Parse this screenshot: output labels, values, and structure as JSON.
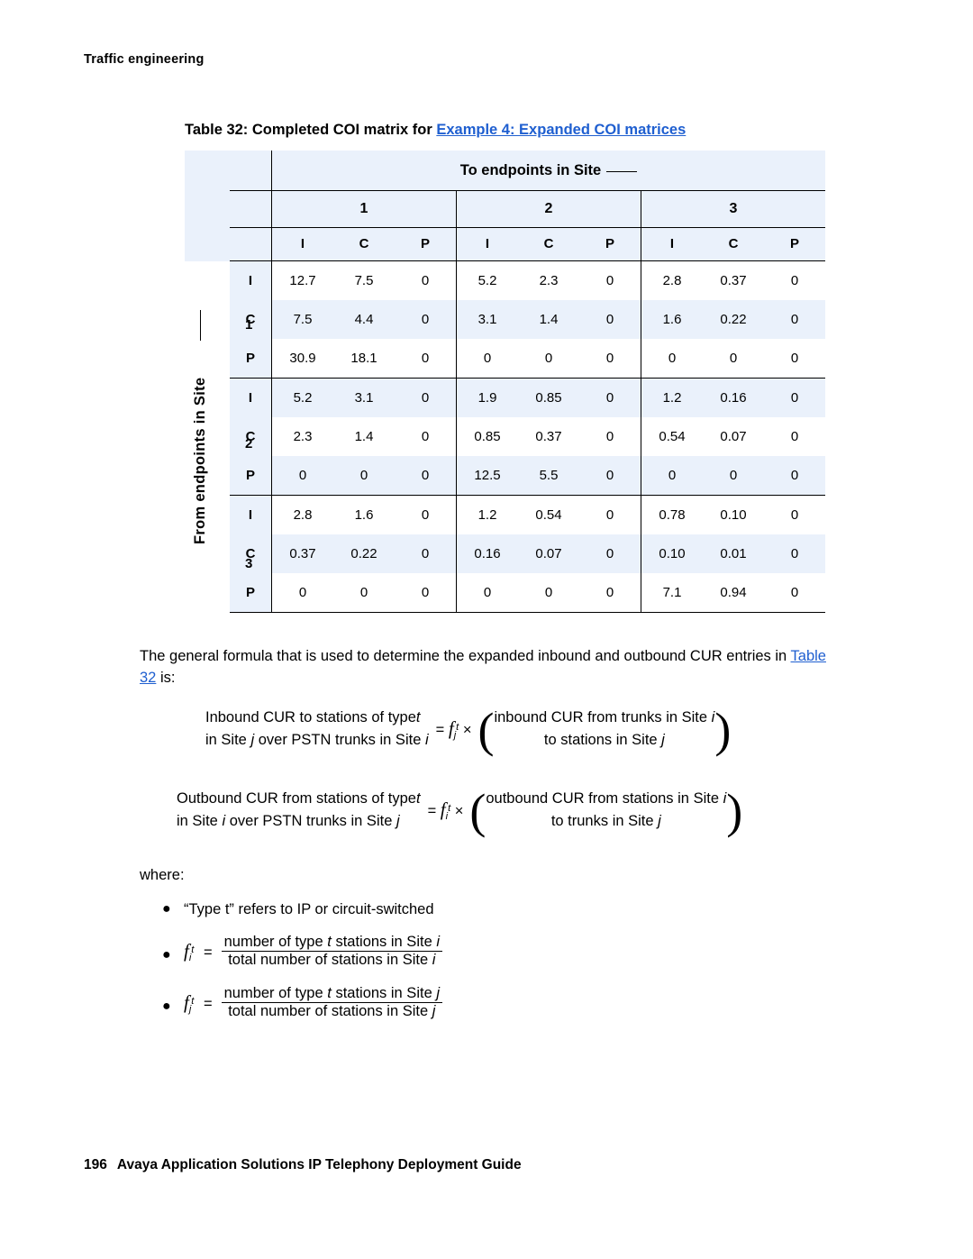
{
  "running_head": "Traffic engineering",
  "caption": {
    "prefix": "Table 32: Completed COI matrix for ",
    "link": "Example 4: Expanded COI matrices"
  },
  "matrix": {
    "col_group_title": "To endpoints in Site",
    "row_group_title": "From endpoints in Site",
    "site_numbers": [
      "1",
      "2",
      "3"
    ],
    "type_labels": [
      "I",
      "C",
      "P"
    ],
    "rows": [
      {
        "site": "1",
        "type": "I",
        "values": [
          "12.7",
          "7.5",
          "0",
          "5.2",
          "2.3",
          "0",
          "2.8",
          "0.37",
          "0"
        ]
      },
      {
        "site": "1",
        "type": "C",
        "values": [
          "7.5",
          "4.4",
          "0",
          "3.1",
          "1.4",
          "0",
          "1.6",
          "0.22",
          "0"
        ]
      },
      {
        "site": "1",
        "type": "P",
        "values": [
          "30.9",
          "18.1",
          "0",
          "0",
          "0",
          "0",
          "0",
          "0",
          "0"
        ]
      },
      {
        "site": "2",
        "type": "I",
        "values": [
          "5.2",
          "3.1",
          "0",
          "1.9",
          "0.85",
          "0",
          "1.2",
          "0.16",
          "0"
        ]
      },
      {
        "site": "2",
        "type": "C",
        "values": [
          "2.3",
          "1.4",
          "0",
          "0.85",
          "0.37",
          "0",
          "0.54",
          "0.07",
          "0"
        ]
      },
      {
        "site": "2",
        "type": "P",
        "values": [
          "0",
          "0",
          "0",
          "12.5",
          "5.5",
          "0",
          "0",
          "0",
          "0"
        ]
      },
      {
        "site": "3",
        "type": "I",
        "values": [
          "2.8",
          "1.6",
          "0",
          "1.2",
          "0.54",
          "0",
          "0.78",
          "0.10",
          "0"
        ]
      },
      {
        "site": "3",
        "type": "C",
        "values": [
          "0.37",
          "0.22",
          "0",
          "0.16",
          "0.07",
          "0",
          "0.10",
          "0.01",
          "0"
        ]
      },
      {
        "site": "3",
        "type": "P",
        "values": [
          "0",
          "0",
          "0",
          "0",
          "0",
          "0",
          "7.1",
          "0.94",
          "0"
        ]
      }
    ]
  },
  "body": {
    "intro_part1": "The general formula that is used to determine the expanded inbound and outbound CUR entries in ",
    "intro_link": "Table 32",
    "intro_part2": " is:",
    "where_label": "where:",
    "bullet_type": "“Type t” refers to IP or circuit-switched"
  },
  "formula1": {
    "lhs_line1_a": "Inbound CUR to stations of type",
    "lhs_line1_t": "t",
    "lhs_line2_a": "in Site",
    "lhs_line2_j": "j",
    "lhs_line2_b": "over PSTN trunks in Site",
    "lhs_line2_i": "i",
    "eq": "=",
    "factor_f": "f",
    "factor_sub": "j",
    "factor_sup": "t",
    "times": "×",
    "rhs_line1_a": "inbound CUR from trunks in Site",
    "rhs_line1_i": "i",
    "rhs_line2_a": "to stations in Site",
    "rhs_line2_j": "j"
  },
  "formula2": {
    "lhs_line1_a": "Outbound CUR from stations of type",
    "lhs_line1_t": "t",
    "lhs_line2_a": "in Site",
    "lhs_line2_i": "i",
    "lhs_line2_b": "over PSTN trunks in Site",
    "lhs_line2_j": "j",
    "eq": "=",
    "factor_f": "f",
    "factor_sub": "i",
    "factor_sup": "t",
    "times": "×",
    "rhs_line1_a": "outbound CUR from stations in Site",
    "rhs_line1_i": "i",
    "rhs_line2_a": "to trunks in Site",
    "rhs_line2_j": "j"
  },
  "formula3": {
    "f": "f",
    "sub": "i",
    "sup": "t",
    "eq": "=",
    "num_a": "number of type",
    "num_t": "t",
    "num_b": "stations in Site",
    "num_i": "i",
    "den_a": "total number of stations in Site",
    "den_i": "i"
  },
  "formula4": {
    "f": "f",
    "sub": "j",
    "sup": "t",
    "eq": "=",
    "num_a": "number of type",
    "num_t": "t",
    "num_b": "stations in Site",
    "num_j": "j",
    "den_a": "total number of stations in Site",
    "den_j": "j"
  },
  "footer": {
    "page": "196",
    "title": "Avaya Application Solutions IP Telephony Deployment Guide"
  }
}
